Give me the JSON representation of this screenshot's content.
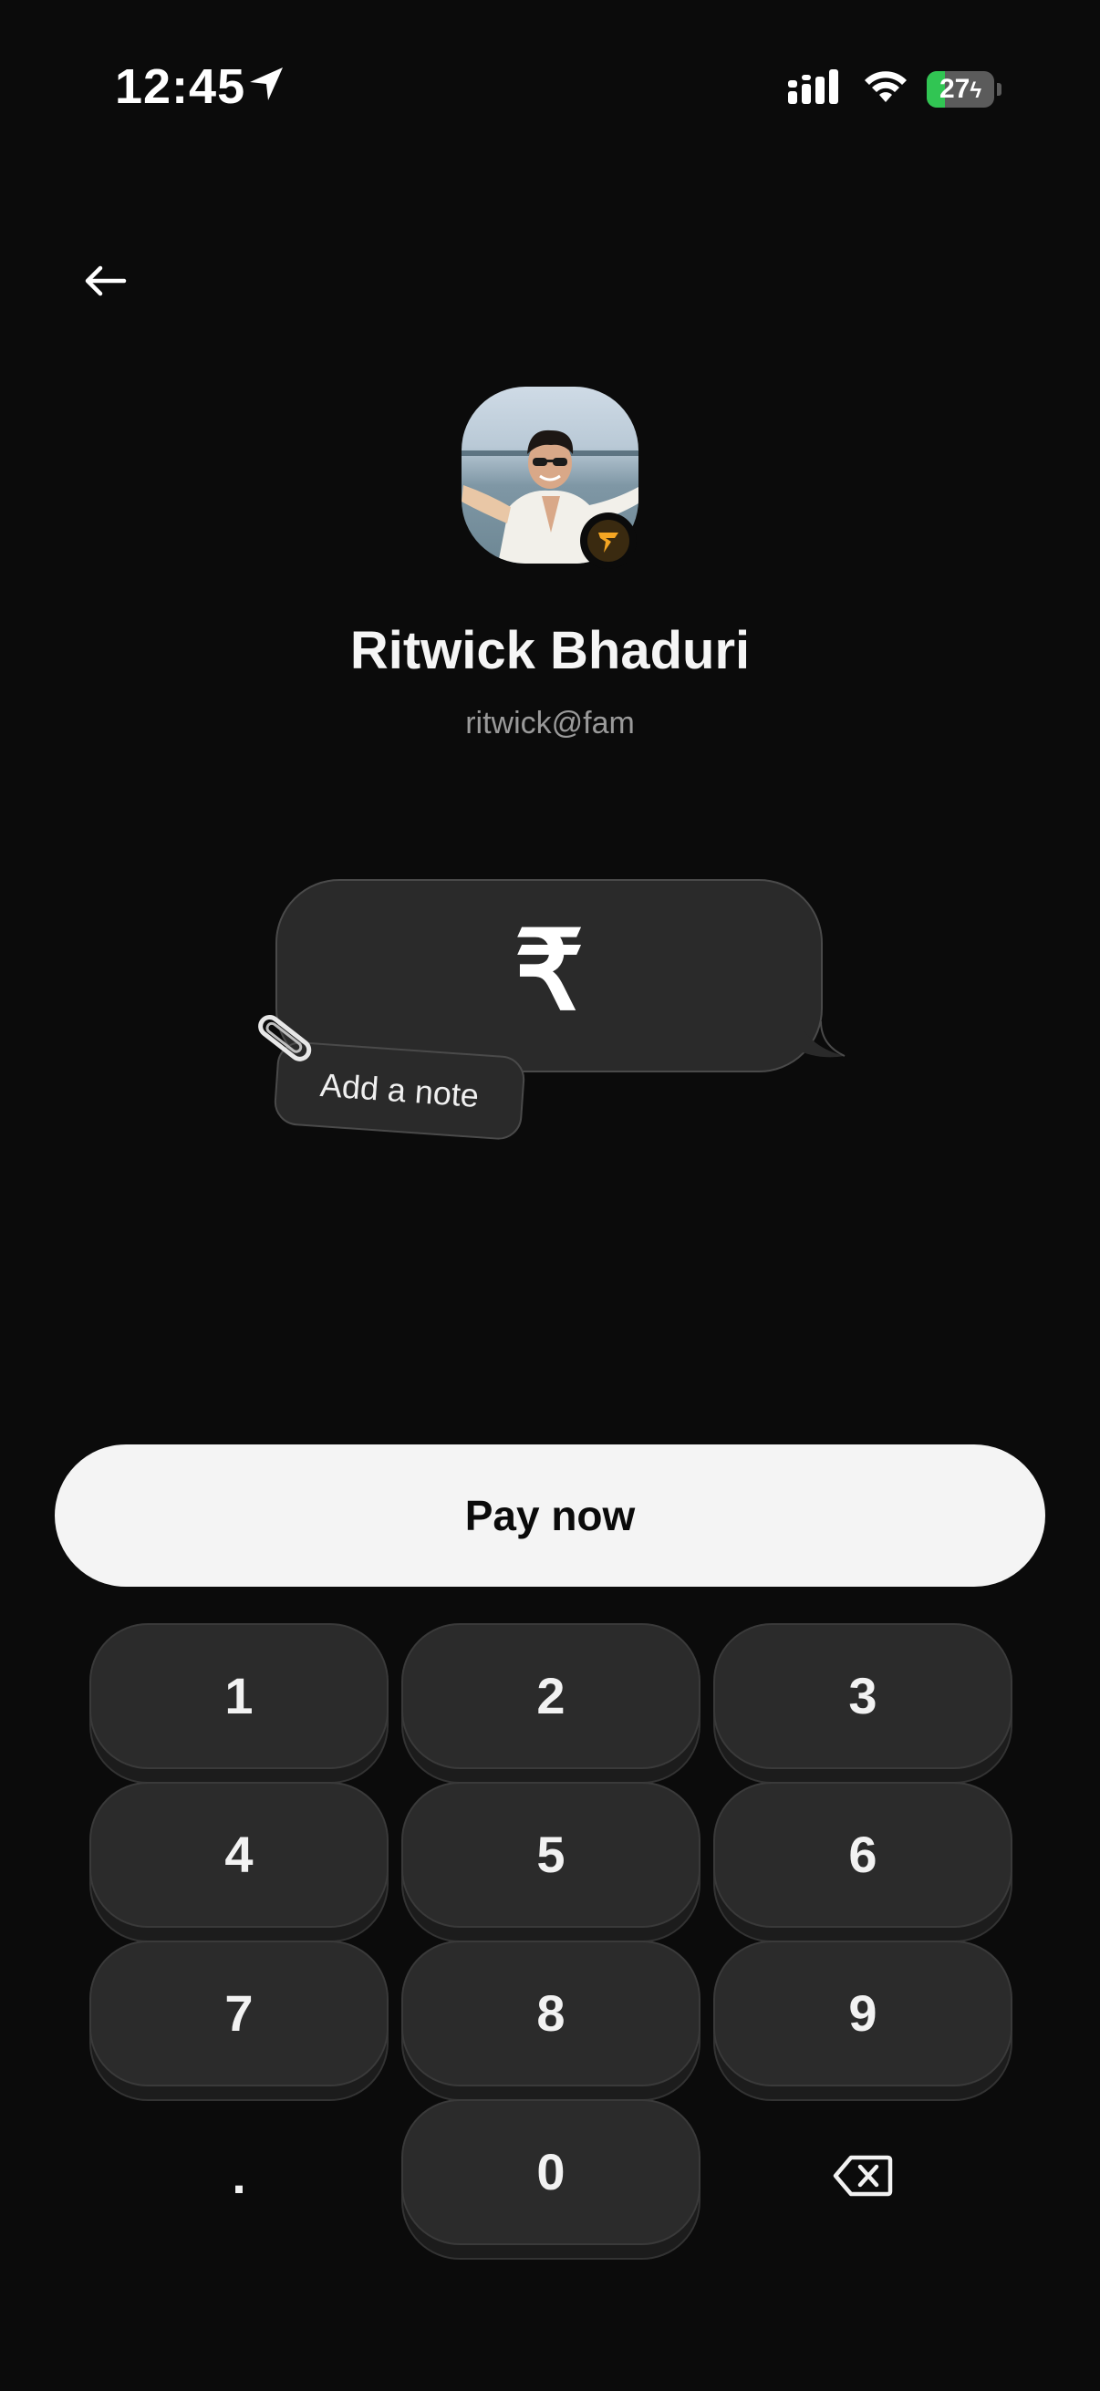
{
  "status_bar": {
    "time": "12:45",
    "battery_percent": 27,
    "battery_label": "27",
    "location_icon": "location-arrow-icon",
    "signal_icon": "cellular-signal-icon",
    "wifi_icon": "wifi-icon",
    "charging_icon": "charging-bolt-icon"
  },
  "header": {
    "back_icon": "arrow-left-icon"
  },
  "recipient": {
    "name": "Ritwick Bhaduri",
    "handle": "ritwick@fam",
    "badge_icon": "fampay-logo-icon"
  },
  "amount": {
    "currency_symbol": "₹",
    "note_label": "Add a note",
    "note_icon": "paperclip-icon"
  },
  "pay_button": {
    "label": "Pay now"
  },
  "keypad": {
    "keys": [
      "1",
      "2",
      "3",
      "4",
      "5",
      "6",
      "7",
      "8",
      "9",
      ".",
      "0"
    ],
    "backspace_icon": "backspace-icon"
  },
  "colors": {
    "background": "#0b0b0b",
    "surface": "#2a2a2a",
    "button_light": "#f4f4f4",
    "battery_green": "#31c553",
    "badge_orange": "#f5a623"
  }
}
